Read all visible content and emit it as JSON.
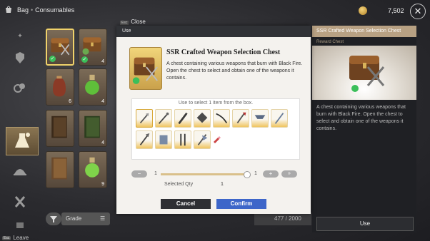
{
  "header": {
    "crumb_main": "Bag",
    "crumb_sub": "Consumables",
    "gold": "7,502",
    "close_symbol": "✕"
  },
  "modal": {
    "close_key": "Esc",
    "close_label": "Close",
    "title": "Use",
    "item_name": "SSR Crafted Weapon Selection Chest",
    "item_desc": "A chest containing various weapons that burn with Black Fire. Open the chest to select and obtain one of the weapons it contains.",
    "select_hint": "Use to select 1 item from the box.",
    "qty_min": "1",
    "qty_max": "1",
    "qty_fraction": 1.0,
    "qty_label": "Selected Qty",
    "qty_value": "1",
    "min_symbol": "−",
    "plus_symbol": "+",
    "max_symbol": "»",
    "cancel": "Cancel",
    "confirm": "Confirm"
  },
  "detail": {
    "title": "SSR Crafted Weapon Selection Chest",
    "subtitle": "Reward Chest",
    "desc": "A chest containing various weapons that burn with Black Fire. Open the chest to select and obtain one of the weapons it contains.",
    "use": "Use"
  },
  "grid": {
    "counts": [
      "4",
      "6",
      "4",
      "4",
      "9"
    ],
    "filter": "Grade",
    "capacity": "477 / 2000"
  },
  "footer": {
    "key": "Esc",
    "leave": "Leave"
  },
  "icons": [
    "bag-icon",
    "gold-coin-icon",
    "close-icon",
    "chest-icon",
    "weapon-icon",
    "filter-icon",
    "sort-icon"
  ],
  "colors": {
    "accent": "#3d66c9",
    "gold": "#f0c560",
    "check": "#3bbf5a"
  }
}
